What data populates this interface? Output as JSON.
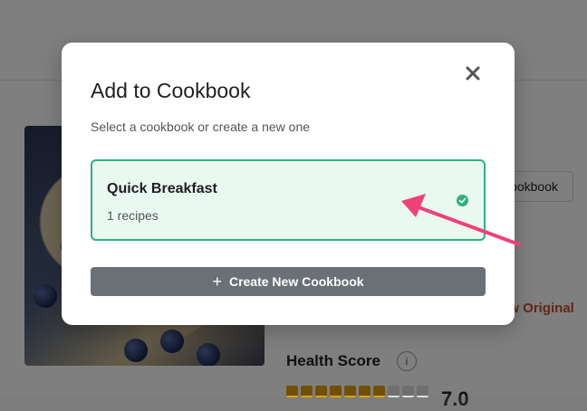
{
  "background": {
    "button_partial_label": "ookbook",
    "link_partial_label": "ew Original",
    "health_score_label": "Health Score",
    "info_icon_label": "i",
    "health_score_value": "7.0",
    "health_score_fraction": 0.7
  },
  "modal": {
    "title": "Add to Cookbook",
    "subtitle": "Select a cookbook or create a new one",
    "close_icon": "close-icon",
    "cookbooks": [
      {
        "name": "Quick Breakfast",
        "count": "1 recipes",
        "selected": true
      }
    ],
    "create_button_label": "Create New Cookbook",
    "create_button_icon": "plus-icon"
  },
  "colors": {
    "accent_green": "#2eb082",
    "selected_bg": "#e9f8f1",
    "create_button_bg": "#6b6f76",
    "annotation_arrow": "#f0407a",
    "health_bar_filled": "#e0a10a",
    "health_bar_empty": "#dedede"
  }
}
